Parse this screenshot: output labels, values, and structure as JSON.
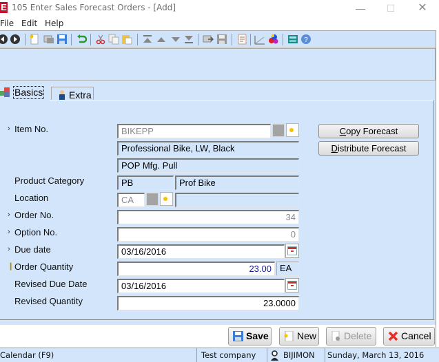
{
  "window": {
    "app_icon": "E",
    "title": "105 Enter Sales Forecast Orders - [Add]",
    "minimize": "—",
    "maximize": "☐",
    "close": "✕"
  },
  "menu": [
    "File",
    "Edit",
    "Help"
  ],
  "toolbar": {
    "icons": [
      "back-icon",
      "forward-icon",
      "new-icon",
      "copy-record-icon",
      "save-icon",
      "undo-icon",
      "cut-icon",
      "copy-icon",
      "paste-icon",
      "first-record-icon",
      "previous-record-icon",
      "next-record-icon",
      "last-record-icon",
      "export-icon",
      "save-disk-icon",
      "notes-icon",
      "chart-icon",
      "palette-icon",
      "calculator-icon",
      "help-icon"
    ]
  },
  "tabs": [
    {
      "label": "Basics",
      "icon": "cubes-icon",
      "active": true
    },
    {
      "label": "Extra",
      "icon": "user-icon",
      "active": false
    }
  ],
  "form": {
    "item_no": {
      "label": "Item No.",
      "value": "BIKEPP",
      "description": "Professional Bike, LW, Black",
      "pull_type": "POP Mfg. Pull"
    },
    "product_category": {
      "label": "Product Category",
      "code": "PB",
      "description": "Prof Bike"
    },
    "location": {
      "label": "Location",
      "value": "CA",
      "description": ""
    },
    "order_no": {
      "label": "Order No.",
      "value": "34"
    },
    "option_no": {
      "label": "Option No.",
      "value": "0"
    },
    "due_date": {
      "label": "Due date",
      "value": "03/16/2016"
    },
    "order_quantity": {
      "label": "Order Quantity",
      "value": "23.00",
      "uom": "EA"
    },
    "revised_due_date": {
      "label": "Revised Due Date",
      "value": "03/16/2016"
    },
    "revised_quantity": {
      "label": "Revised Quantity",
      "value": "23.0000"
    }
  },
  "side_buttons": {
    "copy_forecast": {
      "mnemonic": "C",
      "rest": "opy Forecast"
    },
    "distribute_forecast": {
      "mnemonic": "D",
      "rest": "istribute Forecast"
    }
  },
  "bottom_buttons": {
    "save": "Save",
    "new": "New",
    "delete": "Delete",
    "cancel": "Cancel"
  },
  "status": {
    "hint": "Calendar (F9)",
    "company": "Test company",
    "user": "BIJIMON",
    "date": "Sunday, March 13, 2016"
  },
  "colors": {
    "panel_bg": "#d2e5fa",
    "app_icon": "#c8102e",
    "quantity_text": "#1a1a8a"
  }
}
